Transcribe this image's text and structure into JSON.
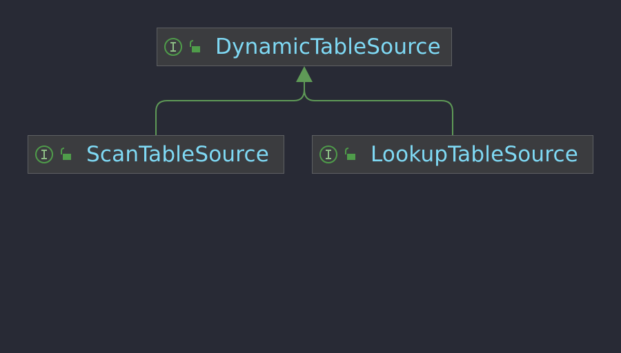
{
  "diagram": {
    "type": "uml-class-hierarchy",
    "root": {
      "label": "DynamicTableSource",
      "kind_icon": "interface-icon",
      "visibility_icon": "public-lock-icon"
    },
    "children": [
      {
        "label": "ScanTableSource",
        "kind_icon": "interface-icon",
        "visibility_icon": "public-lock-icon"
      },
      {
        "label": "LookupTableSource",
        "kind_icon": "interface-icon",
        "visibility_icon": "public-lock-icon"
      }
    ],
    "relation": "extends"
  },
  "colors": {
    "background": "#282a35",
    "node_fill": "#3b3c3f",
    "node_border": "#5e6063",
    "label_text": "#7fd9f4",
    "edge": "#5f9a57",
    "icon_green": "#4f9c4a"
  }
}
